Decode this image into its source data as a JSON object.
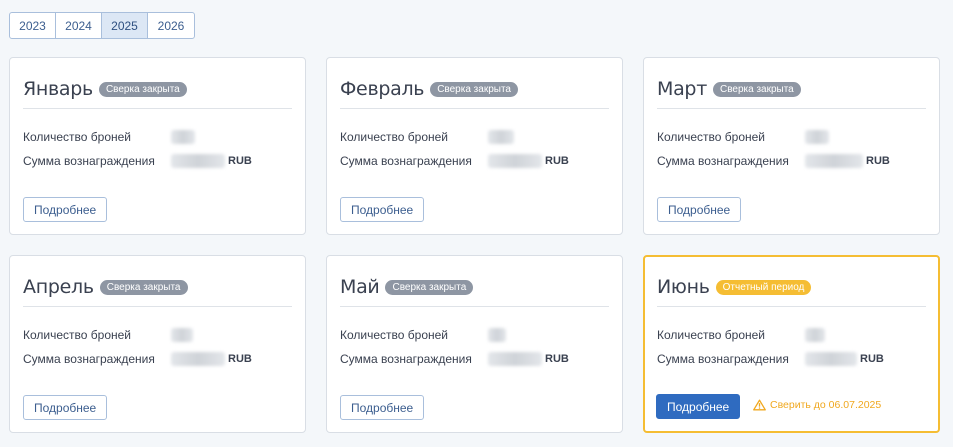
{
  "years": [
    {
      "label": "2023",
      "active": false
    },
    {
      "label": "2024",
      "active": false
    },
    {
      "label": "2025",
      "active": true
    },
    {
      "label": "2026",
      "active": false
    }
  ],
  "labels": {
    "bookings": "Количество броней",
    "reward": "Сумма вознаграждения",
    "currency": "RUB",
    "details": "Подробнее"
  },
  "months": [
    {
      "name": "Январь",
      "status": "Сверка закрыта"
    },
    {
      "name": "Февраль",
      "status": "Сверка закрыта"
    },
    {
      "name": "Март",
      "status": "Сверка закрыта"
    },
    {
      "name": "Апрель",
      "status": "Сверка закрыта"
    },
    {
      "name": "Май",
      "status": "Сверка закрыта"
    },
    {
      "name": "Июнь",
      "status": "Отчетный период",
      "deadline": "Сверить до 06.07.2025"
    }
  ],
  "colors": {
    "accent": "#2f6bc0",
    "closed_badge": "#8e96a3",
    "current_highlight": "#f5bd33",
    "warning_text": "#f0a81f"
  }
}
